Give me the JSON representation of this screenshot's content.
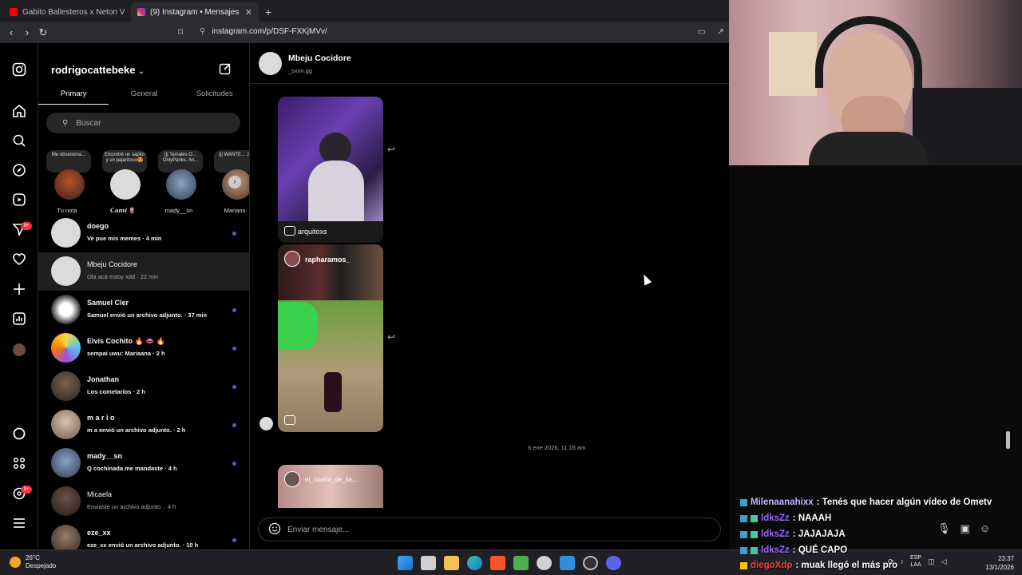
{
  "browser": {
    "tabs": [
      {
        "label": "Gabito Ballesteros x Neton Vega- Wi",
        "color": "#ff0000"
      },
      {
        "label": "(9) Instagram • Mensajes",
        "color": "#d62976"
      }
    ],
    "new_tab": "+",
    "url": "instagram.com/p/DSF-FXKjMVv/"
  },
  "rail": {
    "badge_activity": "9+",
    "badge_threads": "9+"
  },
  "inbox": {
    "username": "rodrigocattebeke",
    "tabs": [
      "Primary",
      "General",
      "Solicitudes"
    ],
    "search_placeholder": "Buscar",
    "notes": [
      {
        "bubble": "Me obsesiona...",
        "name": "Tu nota"
      },
      {
        "bubble": "Encontré un sapito y un pajaritooo😍",
        "name": "𝘾𝙖𝙢𝙞 🌷"
      },
      {
        "bubble": "||| Tamales O... OnlyPanks, An...",
        "name": "mady__sn"
      },
      {
        "bubble": "||| WANTE... Joji",
        "name": "Marians"
      }
    ],
    "conversations": [
      {
        "name": "doego",
        "preview": "Ve pue mis memes · 4 min"
      },
      {
        "name": "Mbeju Cocidore",
        "preview": "Ola acá estoy xdd · 22 min"
      },
      {
        "name": "Samuel Cler",
        "preview": "Samuel envió un archivo adjunto. · 37 min"
      },
      {
        "name": "Elvis Cochito 🔥 👄 🔥",
        "preview": "sempai uwu: Mariaana · 2 h"
      },
      {
        "name": "Jonathan",
        "preview": "Los cometarios · 2 h"
      },
      {
        "name": "m a r i o",
        "preview": "m a envió un archivo adjunto. · 2 h"
      },
      {
        "name": "mady__sn",
        "preview": "Q cochinada me mandaste · 4 h"
      },
      {
        "name": "Micaela",
        "preview": "Enviaste un archivo adjunto. · 4 h"
      },
      {
        "name": "eze_xx",
        "preview": "eze_xx envió un archivo adjunto. · 10 h"
      }
    ]
  },
  "chat": {
    "name": "Mbeju Cocidore",
    "handle": "_sxxn.gg",
    "reel1_author": "arquitoxs",
    "reel2_author": "rapharamos_",
    "reel3_author": "el_cuarto_de_lia...",
    "date_separator": "6 ene 2026, 11:15 am",
    "input_placeholder": "Enviar mensaje..."
  },
  "stream_chat": [
    {
      "user": "Milenaanahixx",
      "text": ": Tenés que hacer algún vídeo de Ometv",
      "color": "#c9b6ff",
      "badge": "blue"
    },
    {
      "user": "ldksZz",
      "text": ": NAAAH",
      "color": "#9b6bff",
      "badge": "blue"
    },
    {
      "user": "ldksZz",
      "text": ": JAJAJAJA",
      "color": "#9b6bff",
      "badge": "blue"
    },
    {
      "user": "ldksZz",
      "text": ": QUÉ CAPO",
      "color": "#9b6bff",
      "badge": "blue"
    },
    {
      "user": "diegoXdp",
      "text": ": muak llegó el más pro",
      "color": "#ff4040",
      "badge": "yellow"
    }
  ],
  "taskbar": {
    "temp": "26°C",
    "weather": "Despejado",
    "lang1": "ESP",
    "lang2": "LAA",
    "time": "23:37",
    "date": "13/1/2026"
  }
}
